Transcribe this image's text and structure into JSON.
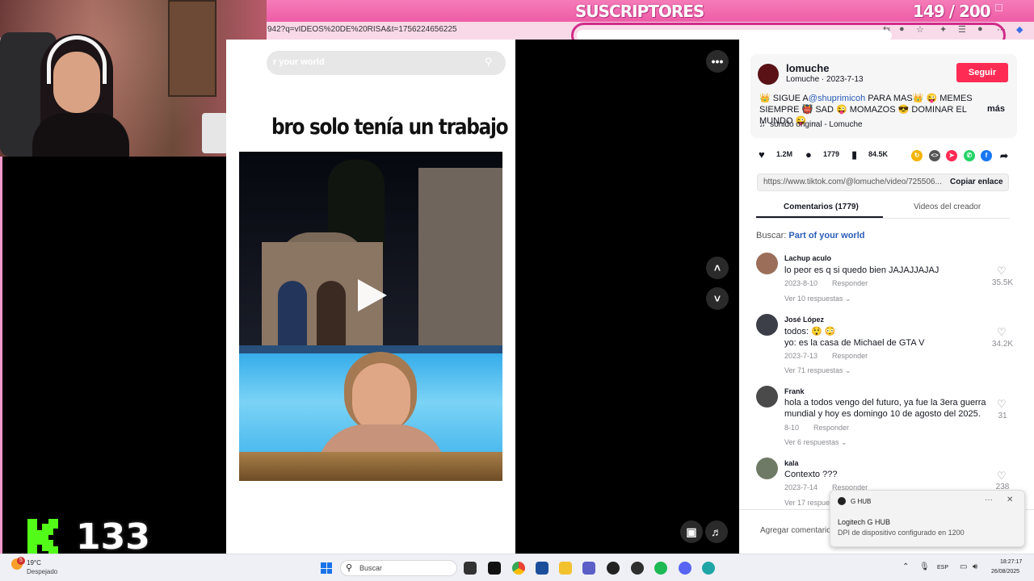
{
  "overlay": {
    "subs_title": "SUSCRIPTORES",
    "subs_count": "149  / 200",
    "subs_progress": 0.745,
    "kick_count": "133"
  },
  "browser": {
    "url": "942?q=vIDEOS%20DE%20RISA&t=1756224656225"
  },
  "video": {
    "search_text": "r your world",
    "meme_caption": "bro solo tenía un trabajo"
  },
  "creator": {
    "name": "lomuche",
    "sub": "Lomuche · 2023-7-13",
    "follow_label": "Seguir",
    "desc_1": "👑 SIGUE A",
    "desc_mention": "@shuprimicoh",
    "desc_2": " PARA MAS👑 😜 MEMES SIEMPRE 👹 SAD 😜 MOMAZOS 😎 DOMINAR EL MUNDO 😜 ...",
    "more_label": "más",
    "sound": "sonido original - Lomuche"
  },
  "stats": {
    "likes": "1.2M",
    "comments": "1779",
    "saves": "84.5K"
  },
  "link": {
    "url": "https://www.tiktok.com/@lomuche/video/725506...",
    "copy_label": "Copiar enlace"
  },
  "tabs": {
    "comments": "Comentarios (1779)",
    "creator_videos": "Videos del creador"
  },
  "search_hint": {
    "prefix": "Buscar: ",
    "query": "Part of your world"
  },
  "comments": [
    {
      "user": "Lachup aculo",
      "text": "lo peor es q si quedo bien JAJAJJAJAJ",
      "date": "2023-8-10",
      "reply": "Responder",
      "replies": "Ver 10 respuestas",
      "likes": "35.5K"
    },
    {
      "user": "José López",
      "text": "todos: 😲 😳",
      "text2": "yo: es la casa de Michael de GTA V",
      "date": "2023-7-13",
      "reply": "Responder",
      "replies": "Ver 71 respuestas",
      "likes": "34.2K"
    },
    {
      "user": "Frank",
      "text": "hola a todos vengo del futuro, ya fue la 3era guerra mundial y hoy es domingo 10 de agosto del 2025.",
      "date": "8-10",
      "reply": "Responder",
      "replies": "Ver 6 respuestas",
      "likes": "31"
    },
    {
      "user": "kala",
      "text": "Contexto ???",
      "date": "2023-7-14",
      "reply": "Responder",
      "replies": "Ver 17 respuestas",
      "likes": "238"
    }
  ],
  "comment_input": {
    "placeholder": "Agregar comentario..."
  },
  "toast": {
    "app": "G HUB",
    "title": "Logitech G HUB",
    "body": "DPI de dispositivo configurado en 1200",
    "dots": "···",
    "close": "✕"
  },
  "taskbar": {
    "weather_badge": "5",
    "temp": "19°C",
    "weather": "Despejado",
    "search_placeholder": "Buscar",
    "lang": "ESP",
    "time": "18:27:17",
    "date": "26/08/2025"
  },
  "colors": {
    "accent": "#fe2c55",
    "overlay_pink": "#ee5ca7",
    "progress_border": "#d12c8a"
  }
}
